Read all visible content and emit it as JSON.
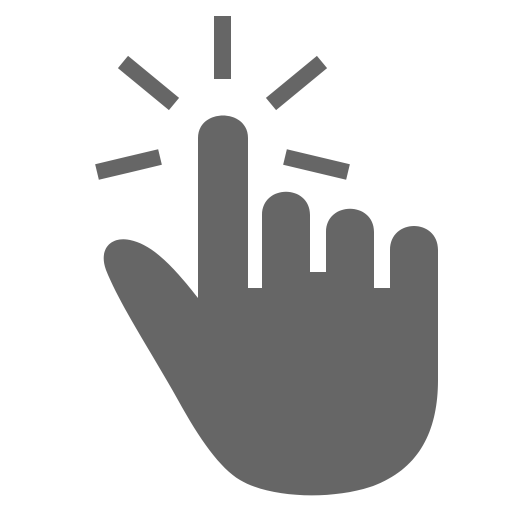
{
  "icon": {
    "name": "tap-gesture-icon",
    "color": "#666666",
    "background": "#ffffff"
  }
}
